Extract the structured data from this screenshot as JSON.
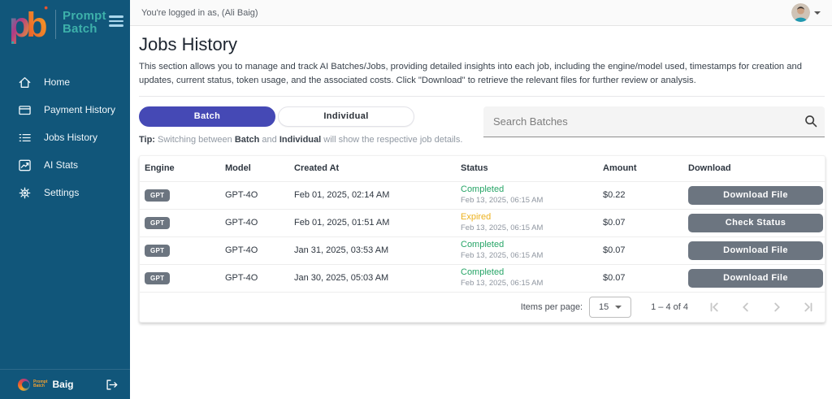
{
  "colors": {
    "sidebar_bg": "#11567a",
    "accent_indigo": "#4549b5",
    "status_completed": "#27a567",
    "status_expired": "#ecb11e",
    "button_gray": "#6c7580",
    "logo_teal": "#3db0aa"
  },
  "sidebar": {
    "logo_line1": "Prompt",
    "logo_line2": "Batch",
    "items": [
      {
        "label": "Home",
        "icon": "home-icon"
      },
      {
        "label": "Payment History",
        "icon": "payment-icon"
      },
      {
        "label": "Jobs History",
        "icon": "list-icon"
      },
      {
        "label": "AI Stats",
        "icon": "chart-icon"
      },
      {
        "label": "Settings",
        "icon": "gear-icon"
      }
    ],
    "footer": {
      "mini_logo_line1": "Prompt",
      "mini_logo_line2": "Batch",
      "username": "Baig"
    }
  },
  "topbar": {
    "logged_in_text": "You're logged in as, (Ali Baig)"
  },
  "page": {
    "title": "Jobs History",
    "description": "This section allows you to manage and track AI Batches/Jobs, providing detailed insights into each job, including the engine/model used, timestamps for creation and updates, current status, token usage, and the associated costs. Click \"Download\" to retrieve the relevant files for further review or analysis."
  },
  "tabs": {
    "batch_label": "Batch",
    "individual_label": "Individual"
  },
  "tip": {
    "label": "Tip:",
    "seg1": " Switching between ",
    "bold1": "Batch",
    "seg2": " and ",
    "bold2": "Individual",
    "seg3": " will show the respective job details."
  },
  "search": {
    "placeholder": "Search Batches"
  },
  "table": {
    "headers": [
      "Engine",
      "Model",
      "Created At",
      "Status",
      "Amount",
      "Download"
    ],
    "rows": [
      {
        "engine": "GPT",
        "model": "GPT-4O",
        "created_at": "Feb 01, 2025, 02:14 AM",
        "status": "Completed",
        "status_date": "Feb 13, 2025, 06:15 AM",
        "amount": "$0.22",
        "action": "Download File"
      },
      {
        "engine": "GPT",
        "model": "GPT-4O",
        "created_at": "Feb 01, 2025, 01:51 AM",
        "status": "Expired",
        "status_date": "Feb 13, 2025, 06:15 AM",
        "amount": "$0.07",
        "action": "Check Status"
      },
      {
        "engine": "GPT",
        "model": "GPT-4O",
        "created_at": "Jan 31, 2025, 03:53 AM",
        "status": "Completed",
        "status_date": "Feb 13, 2025, 06:15 AM",
        "amount": "$0.07",
        "action": "Download File"
      },
      {
        "engine": "GPT",
        "model": "GPT-4O",
        "created_at": "Jan 30, 2025, 05:03 AM",
        "status": "Completed",
        "status_date": "Feb 13, 2025, 06:15 AM",
        "amount": "$0.07",
        "action": "Download File"
      }
    ]
  },
  "paginator": {
    "items_per_page_label": "Items per page:",
    "items_per_page_value": "15",
    "range_label": "1 – 4 of 4"
  }
}
